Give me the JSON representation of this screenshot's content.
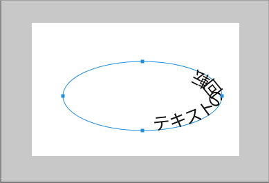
{
  "canvas": {
    "path_text": "テキストの回転",
    "selection_color": "#1e8fdd",
    "text_color": "#111111",
    "workspace_color": "#c8c8c8",
    "page_color": "#ffffff"
  }
}
